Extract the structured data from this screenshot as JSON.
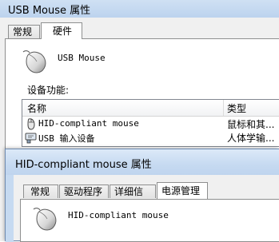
{
  "back_window": {
    "title": "USB Mouse 属性",
    "tabs": [
      {
        "label": "常规",
        "active": false
      },
      {
        "label": "硬件",
        "active": true
      }
    ],
    "device_name": "USB Mouse",
    "functions_label": "设备功能:",
    "columns": [
      "名称",
      "类型"
    ],
    "rows": [
      {
        "name": "HID-compliant mouse",
        "type": "鼠标和其...",
        "icon": "mouse-icon"
      },
      {
        "name": "USB 输入设备",
        "type": "人体学输...",
        "icon": "usb-input-device-icon"
      }
    ]
  },
  "front_window": {
    "title": "HID-compliant mouse 属性",
    "tabs": [
      {
        "label": "常规",
        "active": false
      },
      {
        "label": "驱动程序",
        "active": false
      },
      {
        "label": "详细信息",
        "active": false
      },
      {
        "label": "电源管理",
        "active": true
      }
    ],
    "device_name": "HID-compliant mouse"
  }
}
